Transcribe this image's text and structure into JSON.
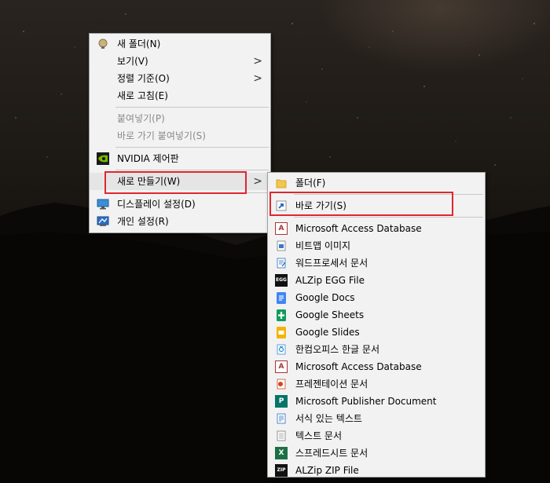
{
  "main_menu": {
    "items": [
      {
        "label": "새 폴더(N)",
        "icon": "new-folder-icon"
      },
      {
        "label": "보기(V)",
        "submenu": true
      },
      {
        "label": "정렬 기준(O)",
        "submenu": true
      },
      {
        "label": "새로 고침(E)"
      },
      {
        "label": "붙여넣기(P)",
        "disabled": true
      },
      {
        "label": "바로 가기 붙여넣기(S)",
        "disabled": true
      },
      {
        "label": "NVIDIA 제어판",
        "icon": "nvidia-icon"
      },
      {
        "label": "새로 만들기(W)",
        "submenu": true
      },
      {
        "label": "디스플레이 설정(D)",
        "icon": "display-icon"
      },
      {
        "label": "개인 설정(R)",
        "icon": "personalize-icon"
      }
    ]
  },
  "sub_menu": {
    "items": [
      {
        "label": "폴더(F)",
        "icon": "folder-icon"
      },
      {
        "label": "바로 가기(S)",
        "icon": "shortcut-icon"
      },
      {
        "label": "Microsoft Access Database",
        "icon": "access-icon"
      },
      {
        "label": "비트맵 이미지",
        "icon": "bitmap-icon"
      },
      {
        "label": "워드프로세서 문서",
        "icon": "wordpad-icon"
      },
      {
        "label": "ALZip EGG File",
        "icon": "egg-icon"
      },
      {
        "label": "Google Docs",
        "icon": "google-docs-icon"
      },
      {
        "label": "Google Sheets",
        "icon": "google-sheets-icon"
      },
      {
        "label": "Google Slides",
        "icon": "google-slides-icon"
      },
      {
        "label": "한컴오피스 한글 문서",
        "icon": "hwp-icon"
      },
      {
        "label": "Microsoft Access Database",
        "icon": "access-icon"
      },
      {
        "label": "프레젠테이션 문서",
        "icon": "presentation-icon"
      },
      {
        "label": "Microsoft Publisher Document",
        "icon": "publisher-icon"
      },
      {
        "label": "서식 있는 텍스트",
        "icon": "rtf-icon"
      },
      {
        "label": "텍스트 문서",
        "icon": "text-doc-icon"
      },
      {
        "label": "스프레드시트 문서",
        "icon": "spreadsheet-icon"
      },
      {
        "label": "ALZip ZIP File",
        "icon": "zip-icon"
      }
    ]
  },
  "submenu_arrow": ">",
  "icon_text": {
    "egg": "EGG",
    "zip": "ZIP",
    "access": "A",
    "publisher": "P",
    "spreadsheet": "X"
  },
  "colors": {
    "highlight_border": "#e0262e",
    "menu_background": "#f2f2f2",
    "disabled_text": "#8a8a8a",
    "nvidia_green": "#76b900",
    "google_docs_blue": "#4285f4",
    "google_sheets_green": "#0f9d58",
    "google_slides_yellow": "#f4b400"
  }
}
